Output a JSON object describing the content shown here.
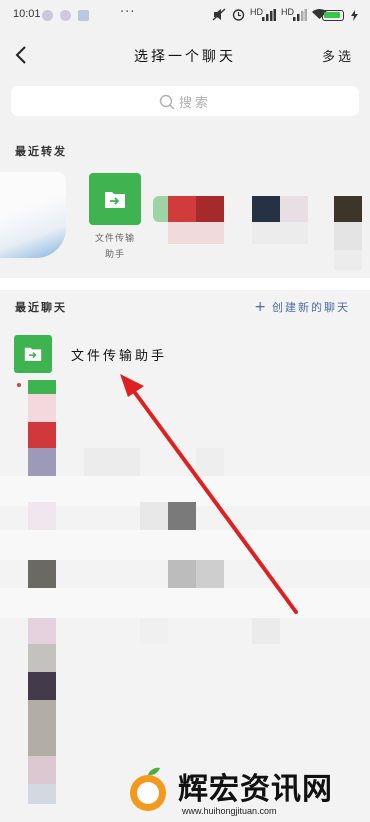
{
  "status_bar": {
    "time": "10:01",
    "dots": "···",
    "hd1": "HD",
    "hd2": "HD",
    "battery_color": "#39c44a"
  },
  "header": {
    "title": "选择一个聊天",
    "multi_select": "多选"
  },
  "search": {
    "placeholder": "搜索"
  },
  "recent_forward": {
    "section_title": "最近转发",
    "items": [
      {
        "label_line1": "文件传输",
        "label_line2": "助手",
        "icon": "folder-transfer-icon",
        "color": "#3fb34f"
      }
    ]
  },
  "recent_chats": {
    "section_title": "最近聊天",
    "create_label": "创建新的聊天",
    "items": [
      {
        "name": "文件传输助手",
        "icon": "folder-transfer-icon",
        "color": "#3fb34f"
      }
    ]
  },
  "watermark": {
    "text": "辉宏资讯网",
    "url": "www.huihongjituan.com"
  },
  "colors": {
    "accent_link": "#4a6da7",
    "arrow": "#e02020"
  }
}
